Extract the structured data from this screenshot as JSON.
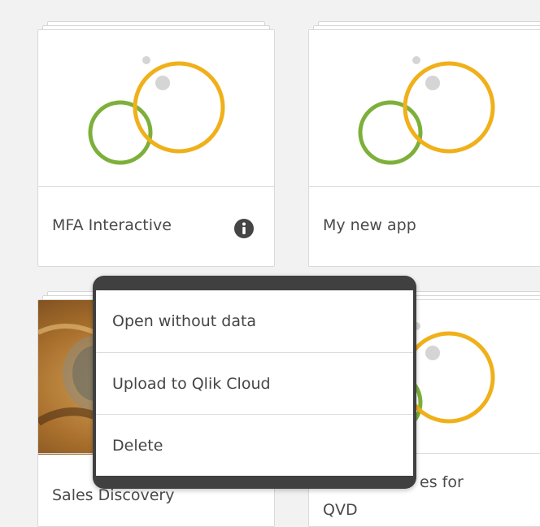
{
  "apps": [
    {
      "title": "MFA Interactive",
      "has_info": true,
      "thumbnail": "qlik-circles"
    },
    {
      "title": "My new app",
      "has_info": false,
      "thumbnail": "qlik-circles"
    },
    {
      "title": "Sales Discovery",
      "has_info": false,
      "thumbnail": "photo"
    },
    {
      "title_partial": "es for",
      "title_partial_line2": "QVD",
      "thumbnail": "qlik-circles"
    }
  ],
  "context_menu": {
    "items": [
      {
        "label": "Open without data"
      },
      {
        "label": "Upload to Qlik Cloud"
      },
      {
        "label": "Delete"
      }
    ]
  },
  "icons": {
    "info": "info-circle-icon"
  },
  "colors": {
    "green": "#7db03a",
    "orange": "#f0b01a",
    "menu_frame": "#404040",
    "background": "#f2f2f2"
  }
}
